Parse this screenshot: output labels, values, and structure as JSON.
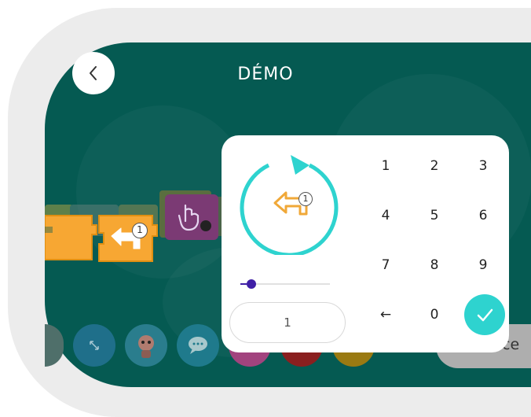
{
  "header": {
    "title": "DÉMO"
  },
  "program": {
    "selected_block_badge": "1"
  },
  "repeat_editor": {
    "icon_badge": "1",
    "slider_value": 0,
    "count_value": "1",
    "keypad": [
      "1",
      "2",
      "3",
      "4",
      "5",
      "6",
      "7",
      "8",
      "9",
      "←",
      "0"
    ]
  },
  "toolbar": {
    "partial_button_text": "ce"
  },
  "colors": {
    "background": "#055a52",
    "accent": "#2ed3cf",
    "block_orange": "#f7a733",
    "block_purple": "#9c3f8c",
    "slider": "#3f1fa6"
  }
}
